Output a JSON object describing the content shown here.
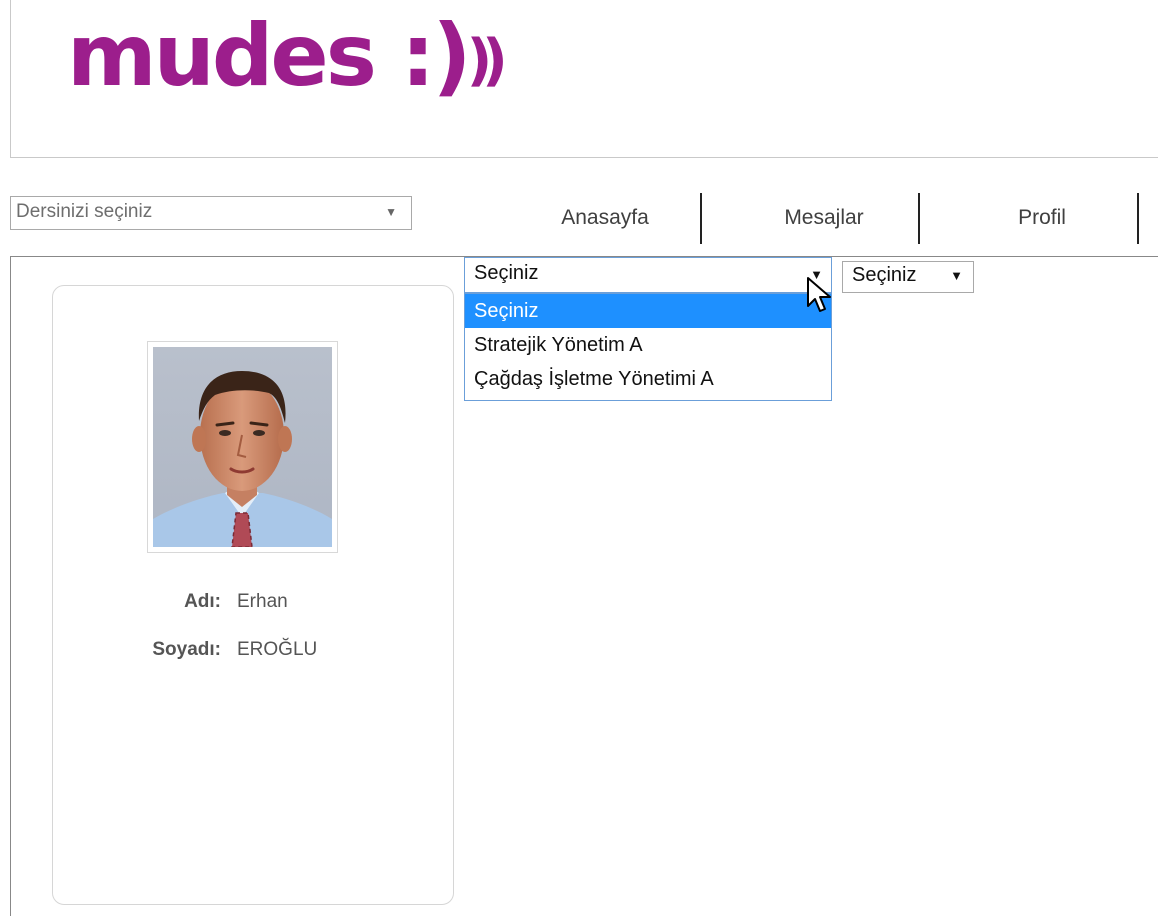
{
  "brand": {
    "logo_text": "mudes :)",
    "logo_waves": "))",
    "color": "#9c1e8c"
  },
  "course_select": {
    "placeholder": "Dersinizi seçiniz"
  },
  "nav": {
    "items": [
      {
        "label": "Anasayfa"
      },
      {
        "label": "Mesajlar"
      },
      {
        "label": "Profil"
      }
    ]
  },
  "profile": {
    "first_name_label": "Adı:",
    "first_name": "Erhan",
    "last_name_label": "Soyadı:",
    "last_name": "EROĞLU"
  },
  "class_dropdown": {
    "selected": "Seçiniz",
    "options": [
      {
        "label": "Seçiniz",
        "selected": true
      },
      {
        "label": "Stratejik Yönetim A",
        "selected": false
      },
      {
        "label": "Çağdaş İşletme Yönetimi A",
        "selected": false
      }
    ],
    "accent": "#1e90ff"
  },
  "second_dropdown": {
    "selected": "Seçiniz"
  },
  "icons": {
    "dropdown_arrow": "triangle-down-icon",
    "cursor": "mouse-pointer-icon"
  }
}
